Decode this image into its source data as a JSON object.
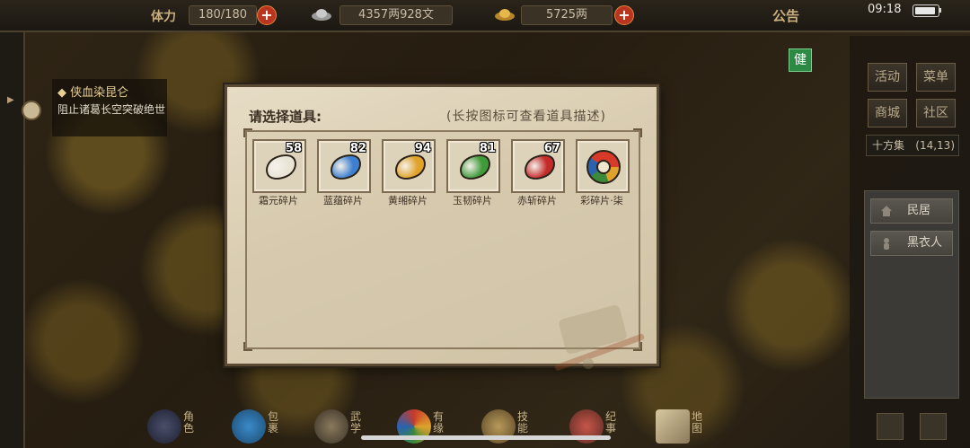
{
  "topbar": {
    "stamina_label": "体力",
    "stamina_value": "180/180",
    "money_value": "4357两928文",
    "gold_value": "5725两",
    "announcement": "公告",
    "time": "09:18",
    "battery_level": 0.9
  },
  "quest": {
    "title": "◆ 侠血染昆仑",
    "description": "阻止诸葛长空突破绝世"
  },
  "health_badge": "健",
  "right_panel": {
    "buttons": [
      "活动",
      "菜单",
      "商城",
      "社区"
    ],
    "location_name": "十方集",
    "location_coord": "(14,13)",
    "npcs": [
      "民居",
      "黑衣人"
    ]
  },
  "dialog": {
    "title": "请选择道具:",
    "hint": "(长按图标可查看道具描述)",
    "items": [
      {
        "name": "霜元碎片",
        "count": "58",
        "color": "#e9e4d6"
      },
      {
        "name": "蓝蕴碎片",
        "count": "82",
        "color": "#3d7fd0"
      },
      {
        "name": "黄缃碎片",
        "count": "94",
        "color": "#e0a22a"
      },
      {
        "name": "玉韧碎片",
        "count": "81",
        "color": "#3f9a3a"
      },
      {
        "name": "赤斩碎片",
        "count": "67",
        "color": "#c42a2a"
      },
      {
        "name": "彩碎片·柒",
        "count": "",
        "color": "multi"
      }
    ]
  },
  "dock": [
    {
      "label": "角色",
      "icon": "character-icon"
    },
    {
      "label": "包裹",
      "icon": "bag-icon"
    },
    {
      "label": "武学",
      "icon": "martial-icon"
    },
    {
      "label": "有缘",
      "icon": "fate-icon"
    },
    {
      "label": "技能",
      "icon": "skill-icon"
    },
    {
      "label": "纪事",
      "icon": "chronicle-icon"
    },
    {
      "label": "地图",
      "icon": "map-icon"
    }
  ]
}
